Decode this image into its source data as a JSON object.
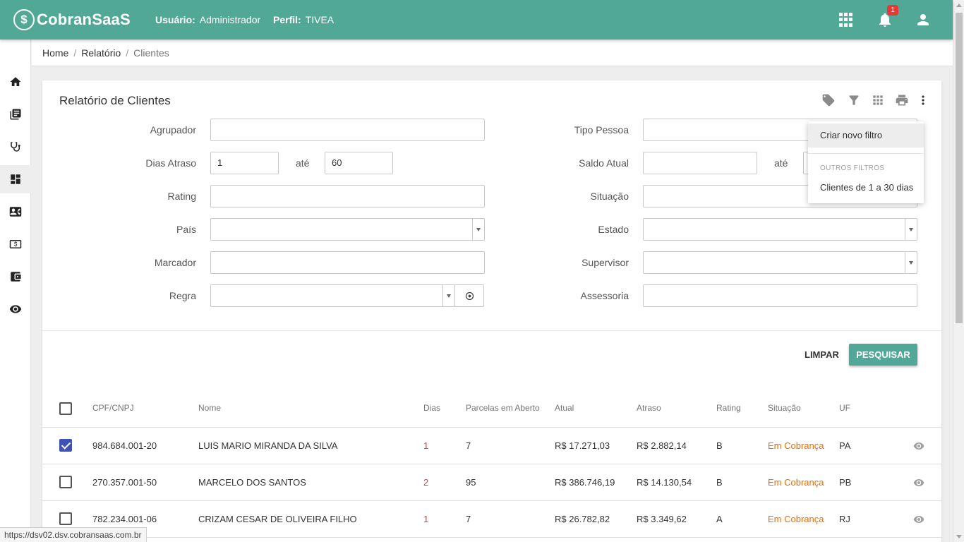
{
  "header": {
    "logo_text": "CobranSaaS",
    "user_label": "Usuário:",
    "user_value": "Administrador",
    "perfil_label": "Perfil:",
    "perfil_value": "TIVEA",
    "notifications_count": "1",
    "icons": [
      "apps-icon",
      "bell-icon",
      "user-icon"
    ]
  },
  "sidebar": {
    "items": [
      {
        "name": "home"
      },
      {
        "name": "book"
      },
      {
        "name": "stethoscope"
      },
      {
        "name": "dashboard",
        "active": true
      },
      {
        "name": "contact-card"
      },
      {
        "name": "money"
      },
      {
        "name": "wallet"
      },
      {
        "name": "eye"
      }
    ]
  },
  "breadcrumb": {
    "items": [
      "Home",
      "Relatório",
      "Clientes"
    ],
    "separator": "/"
  },
  "report": {
    "title": "Relatório de Clientes",
    "toolbar": [
      "tag-icon",
      "filter-icon",
      "grid-icon",
      "print-icon",
      "more-vert-icon"
    ]
  },
  "filters": {
    "agrupador": {
      "label": "Agrupador",
      "value": ""
    },
    "dias_atraso": {
      "label": "Dias Atraso",
      "from": "1",
      "to_label": "até",
      "to": "60"
    },
    "rating": {
      "label": "Rating",
      "value": ""
    },
    "pais": {
      "label": "País",
      "value": ""
    },
    "marcador": {
      "label": "Marcador",
      "value": ""
    },
    "regra": {
      "label": "Regra",
      "value": ""
    },
    "tipo_pessoa": {
      "label": "Tipo Pessoa",
      "value": ""
    },
    "saldo_atual": {
      "label": "Saldo Atual",
      "from": "",
      "to_label": "até",
      "to": ""
    },
    "situacao": {
      "label": "Situação",
      "value": ""
    },
    "estado": {
      "label": "Estado",
      "value": ""
    },
    "supervisor": {
      "label": "Supervisor",
      "value": ""
    },
    "assessoria": {
      "label": "Assessoria",
      "value": ""
    }
  },
  "actions": {
    "clear_label": "LIMPAR",
    "search_label": "PESQUISAR"
  },
  "table": {
    "columns": [
      "CPF/CNPJ",
      "Nome",
      "Dias",
      "Parcelas em Aberto",
      "Atual",
      "Atraso",
      "Rating",
      "Situação",
      "UF"
    ],
    "rows": [
      {
        "checked": true,
        "cpf": "984.684.001-20",
        "nome": "LUIS MARIO MIRANDA DA SILVA",
        "dias": "1",
        "parcelas": "7",
        "atual": "R$ 17.271,03",
        "atraso": "R$ 2.882,14",
        "rating": "B",
        "situacao": "Em Cobrança",
        "uf": "PA"
      },
      {
        "checked": false,
        "cpf": "270.357.001-50",
        "nome": "MARCELO DOS SANTOS",
        "dias": "2",
        "parcelas": "95",
        "atual": "R$ 386.746,19",
        "atraso": "R$ 14.130,54",
        "rating": "B",
        "situacao": "Em Cobrança",
        "uf": "PB"
      },
      {
        "checked": false,
        "cpf": "782.234.001-06",
        "nome": "CRIZAM CESAR DE OLIVEIRA FILHO",
        "dias": "1",
        "parcelas": "7",
        "atual": "R$ 26.782,82",
        "atraso": "R$ 3.349,62",
        "rating": "A",
        "situacao": "Em Cobrança",
        "uf": "RJ"
      }
    ]
  },
  "menu": {
    "create_label": "Criar novo filtro",
    "section_label": "OUTROS FILTROS",
    "saved_filter": "Clientes de 1 a 30 dias"
  },
  "status_url": "https://dsv02.dsv.cobransaas.com.br",
  "colors": {
    "brand": "#52a896",
    "checkbox": "#3f51b5",
    "days_red": "#e53935",
    "status_orange": "#ef6c00"
  }
}
